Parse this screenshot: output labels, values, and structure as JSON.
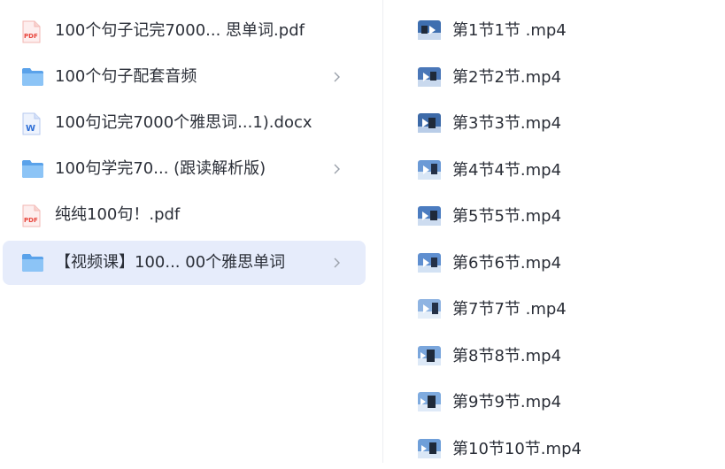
{
  "left_panel": {
    "items": [
      {
        "icon": "pdf-file-icon",
        "name": "100个句子记完7000...  思单词.pdf",
        "type": "pdf",
        "has_children": false,
        "selected": false
      },
      {
        "icon": "folder-icon",
        "name": "100个句子配套音频",
        "type": "folder",
        "has_children": true,
        "selected": false
      },
      {
        "icon": "word-doc-icon",
        "name": "100句记完7000个雅思词...1).docx",
        "type": "docx",
        "has_children": false,
        "selected": false
      },
      {
        "icon": "folder-icon",
        "name": "100句学完70...   (跟读解析版)",
        "type": "folder",
        "has_children": true,
        "selected": false
      },
      {
        "icon": "pdf-file-icon",
        "name": "纯纯100句！.pdf",
        "type": "pdf",
        "has_children": false,
        "selected": false
      },
      {
        "icon": "folder-icon",
        "name": "【视频课】100...  00个雅思单词",
        "type": "folder",
        "has_children": true,
        "selected": true
      }
    ]
  },
  "right_panel": {
    "items": [
      {
        "icon": "video-thumbnail-icon",
        "name": "第1节1节 .mp4"
      },
      {
        "icon": "video-thumbnail-icon",
        "name": "第2节2节.mp4"
      },
      {
        "icon": "video-thumbnail-icon",
        "name": "第3节3节.mp4"
      },
      {
        "icon": "video-thumbnail-icon",
        "name": "第4节4节.mp4"
      },
      {
        "icon": "video-thumbnail-icon",
        "name": "第5节5节.mp4"
      },
      {
        "icon": "video-thumbnail-icon",
        "name": "第6节6节.mp4"
      },
      {
        "icon": "video-thumbnail-icon",
        "name": "第7节7节 .mp4"
      },
      {
        "icon": "video-thumbnail-icon",
        "name": "第8节8节.mp4"
      },
      {
        "icon": "video-thumbnail-icon",
        "name": "第9节9节.mp4"
      },
      {
        "icon": "video-thumbnail-icon",
        "name": "第10节10节.mp4"
      }
    ]
  },
  "colors": {
    "selected_bg": "#e6ecfb",
    "folder": "#6aaef0",
    "pdf_red": "#e8453c",
    "word_blue": "#2f6fd6",
    "text": "#2b2f38",
    "chevron": "#9aa0aa"
  }
}
